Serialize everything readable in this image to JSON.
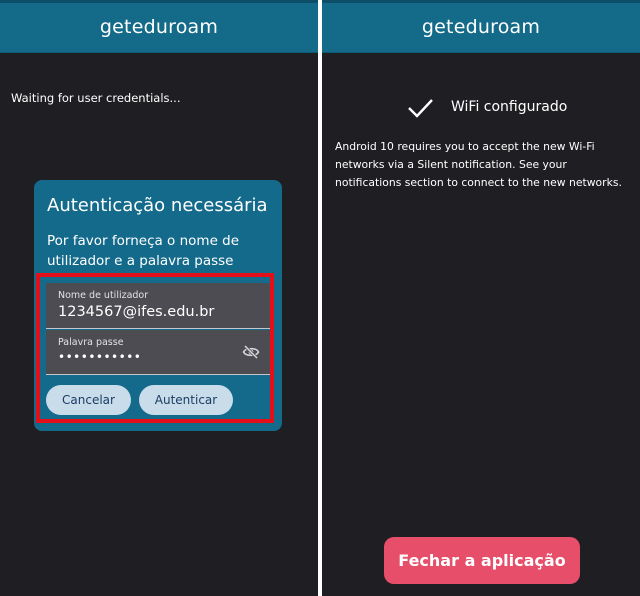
{
  "left": {
    "appbar": {
      "title": "geteduroam"
    },
    "status_text": "Waiting for user credentials...",
    "dialog": {
      "title": "Autenticação necessária",
      "message": "Por favor forneça o nome de utilizador e a palavra passe",
      "username": {
        "label": "Nome de utilizador",
        "value": "1234567@ifes.edu.br"
      },
      "password": {
        "label": "Palavra passe",
        "value": "•••••••••••",
        "icon": "eye-off-icon"
      },
      "buttons": {
        "cancel": "Cancelar",
        "authenticate": "Autenticar"
      }
    }
  },
  "right": {
    "appbar": {
      "title": "geteduroam"
    },
    "status": {
      "icon": "check-icon",
      "text": "WiFi configurado"
    },
    "note": "Android 10 requires you to accept the new Wi-Fi networks via a Silent notification. See your notifications section to connect to the new networks.",
    "close_button": "Fechar a aplicação"
  },
  "colors": {
    "appbar": "#136a89",
    "background": "#1f1e22",
    "dialog": "#146a8b",
    "highlight_border": "#e3101a",
    "button": "#c9dcea",
    "close_button": "#e64e6a"
  }
}
